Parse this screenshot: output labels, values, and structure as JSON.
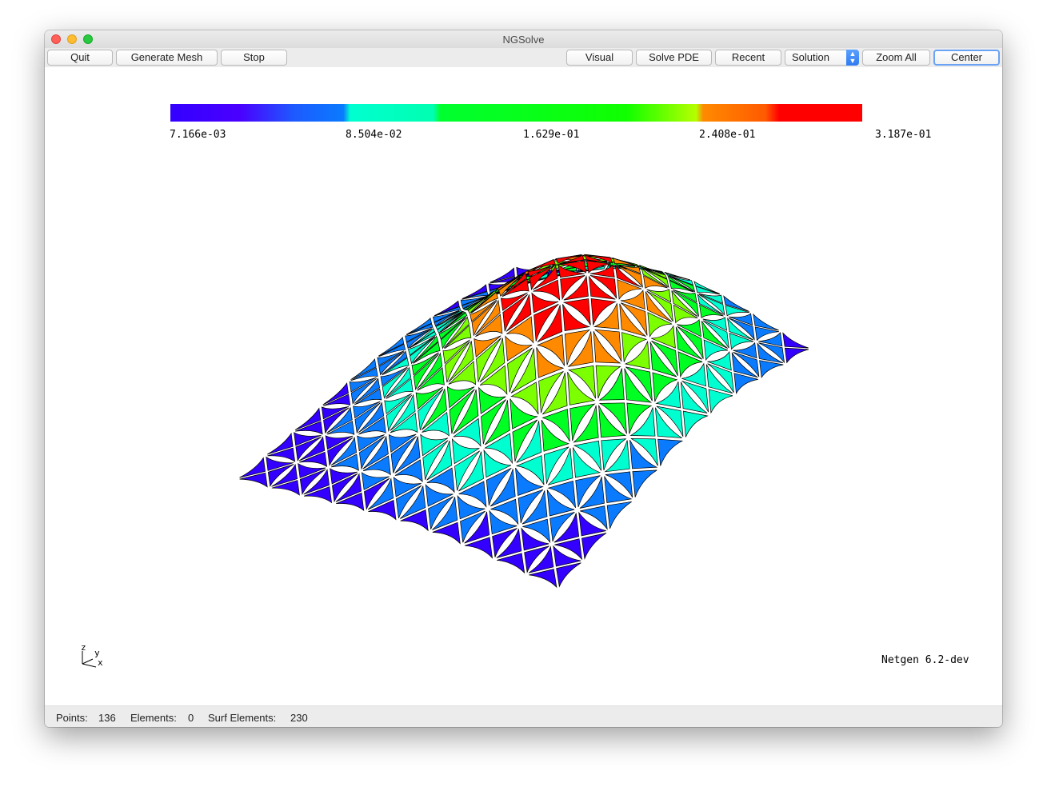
{
  "window": {
    "title": "NGSolve"
  },
  "toolbar": {
    "quit": "Quit",
    "generate_mesh": "Generate Mesh",
    "stop": "Stop",
    "visual": "Visual",
    "solve_pde": "Solve PDE",
    "recent": "Recent",
    "solution_select": "Solution",
    "zoom_all": "Zoom All",
    "center": "Center"
  },
  "colorbar": {
    "labels": [
      "7.166e-03",
      "8.504e-02",
      "1.629e-01",
      "2.408e-01",
      "3.187e-01"
    ],
    "colors": [
      "#3300ff",
      "#0a7bff",
      "#00ffd0",
      "#00ff22",
      "#7cff00",
      "#ff8a00",
      "#ff0000"
    ]
  },
  "axes": {
    "z": "z",
    "y": "y",
    "x": "x"
  },
  "version": "Netgen 6.2-dev",
  "status": {
    "points_label": "Points:",
    "points_value": "136",
    "elements_label": "Elements:",
    "elements_value": "0",
    "surf_label": "Surf Elements:",
    "surf_value": "230"
  }
}
